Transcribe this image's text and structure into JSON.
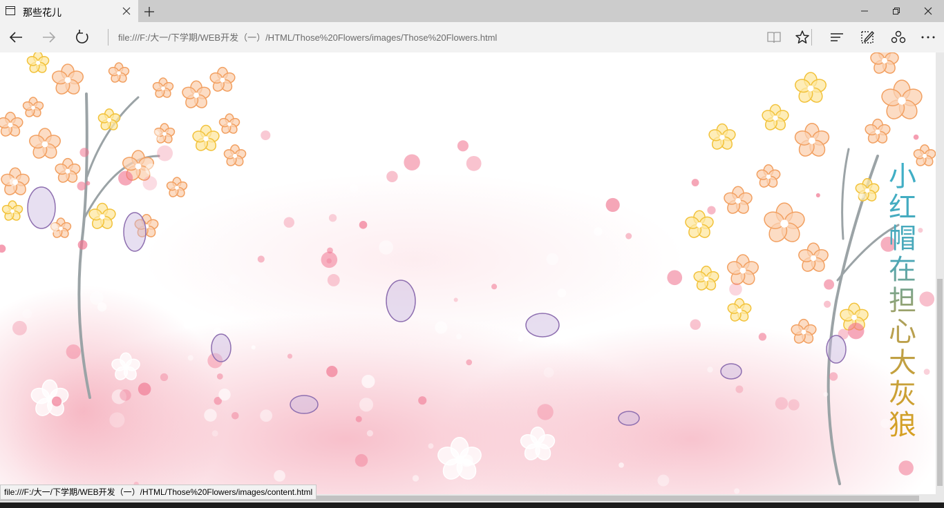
{
  "tab": {
    "title": "那些花儿",
    "icon": "page-icon"
  },
  "toolbar": {
    "url": "file:///F:/大一/下学期/WEB开发（一）/HTML/Those%20Flowers/images/Those%20Flowers.html",
    "back_icon": "back-arrow-icon",
    "forward_icon": "forward-arrow-icon",
    "refresh_icon": "refresh-icon",
    "reading_view_icon": "reading-view-icon",
    "favorite_icon": "star-icon",
    "hub_icon": "hub-icon",
    "note_icon": "web-note-icon",
    "share_icon": "share-icon",
    "more_icon": "more-icon"
  },
  "page": {
    "title_chars": [
      "小",
      "红",
      "帽",
      "在",
      "担",
      "心",
      "大",
      "灰",
      "狼"
    ],
    "title_colors": [
      "#3fb0c8",
      "#d8a020"
    ]
  },
  "statusbar": {
    "link": "file:///F:/大一/下学期/WEB开发（一）/HTML/Those%20Flowers/images/content.html"
  },
  "colors": {
    "tab_strip": "#cccccc",
    "chrome": "#f2f2f2",
    "petal_orange": "#f7b27a",
    "petal_pink": "#f4a7b5",
    "petal_purple": "#b9a6d2"
  }
}
